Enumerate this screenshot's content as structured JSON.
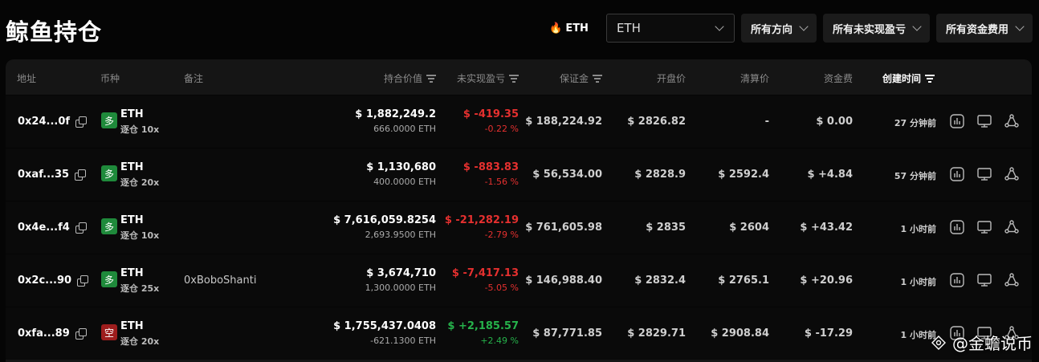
{
  "page": {
    "title": "鲸鱼持仓"
  },
  "filters": {
    "coin_tag": "ETH",
    "coin_select": "ETH",
    "direction": "所有方向",
    "pnl": "所有未实现盈亏",
    "funding": "所有资金费用"
  },
  "table": {
    "headers": {
      "address": "地址",
      "coin": "币种",
      "note": "备注",
      "value": "持合价值",
      "pnl": "未实现盈亏",
      "margin": "保证金",
      "open": "开盘价",
      "liq": "清算价",
      "funding": "资金费",
      "time": "创建时间"
    },
    "rows": [
      {
        "address": "0x24...0f",
        "side": "多",
        "coin": "ETH",
        "mode": "逐仓 10x",
        "note": "",
        "value": "$ 1,882,249.2",
        "qty": "666.0000 ETH",
        "pnl": "$ -419.35",
        "pnl_pct": "-0.22 %",
        "margin": "$ 188,224.92",
        "open": "$ 2826.82",
        "liq": "-",
        "funding": "$ 0.00",
        "time": "27 分钟前"
      },
      {
        "address": "0xaf...35",
        "side": "多",
        "coin": "ETH",
        "mode": "逐仓 20x",
        "note": "",
        "value": "$ 1,130,680",
        "qty": "400.0000 ETH",
        "pnl": "$ -883.83",
        "pnl_pct": "-1.56 %",
        "margin": "$ 56,534.00",
        "open": "$ 2828.9",
        "liq": "$ 2592.4",
        "funding": "$ +4.84",
        "time": "57 分钟前"
      },
      {
        "address": "0x4e...f4",
        "side": "多",
        "coin": "ETH",
        "mode": "逐仓 10x",
        "note": "",
        "value": "$ 7,616,059.8254",
        "qty": "2,693.9500 ETH",
        "pnl": "$ -21,282.19",
        "pnl_pct": "-2.79 %",
        "margin": "$ 761,605.98",
        "open": "$ 2835",
        "liq": "$ 2604",
        "funding": "$ +43.42",
        "time": "1 小时前"
      },
      {
        "address": "0x2c...90",
        "side": "多",
        "coin": "ETH",
        "mode": "逐仓 25x",
        "note": "0xBoboShanti",
        "value": "$ 3,674,710",
        "qty": "1,300.0000 ETH",
        "pnl": "$ -7,417.13",
        "pnl_pct": "-5.05 %",
        "margin": "$ 146,988.40",
        "open": "$ 2832.4",
        "liq": "$ 2765.1",
        "funding": "$ +20.96",
        "time": "1 小时前"
      },
      {
        "address": "0xfa...89",
        "side": "空",
        "coin": "ETH",
        "mode": "逐仓 20x",
        "note": "",
        "value": "$ 1,755,437.0408",
        "qty": "-621.1300 ETH",
        "pnl": "$ +2,185.57",
        "pnl_pct": "+2.49 %",
        "margin": "$ 87,771.85",
        "open": "$ 2829.71",
        "liq": "$ 2908.84",
        "funding": "$ -17.29",
        "time": "1 小时前"
      }
    ]
  },
  "watermark": {
    "text": "@金蟾说币"
  },
  "colors": {
    "long": "#1f8a3b",
    "short": "#9e1d1d",
    "negative": "#e5302f",
    "positive": "#26b24b"
  }
}
